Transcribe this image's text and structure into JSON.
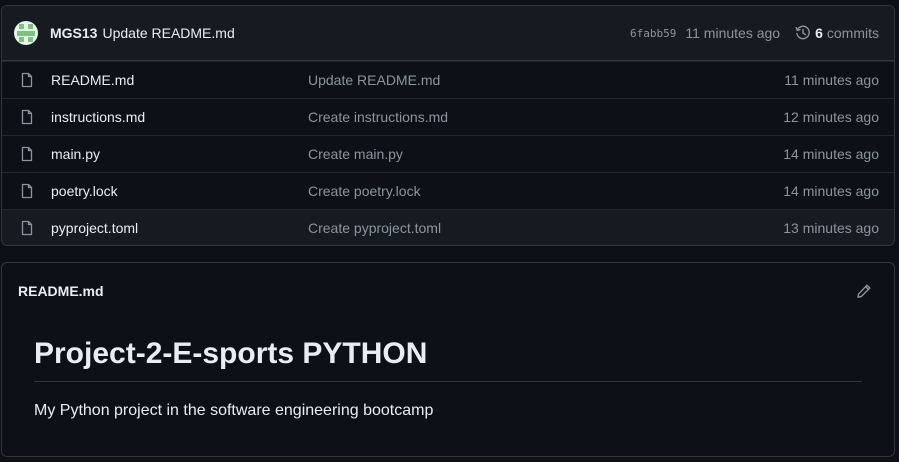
{
  "latest_commit": {
    "author": "MGS13",
    "message": "Update README.md",
    "sha": "6fabb59",
    "time": "11 minutes ago",
    "commits_count": "6",
    "commits_label": "commits"
  },
  "files": [
    {
      "name": "README.md",
      "commit": "Update README.md",
      "time": "11 minutes ago"
    },
    {
      "name": "instructions.md",
      "commit": "Create instructions.md",
      "time": "12 minutes ago"
    },
    {
      "name": "main.py",
      "commit": "Create main.py",
      "time": "14 minutes ago"
    },
    {
      "name": "poetry.lock",
      "commit": "Create poetry.lock",
      "time": "14 minutes ago"
    },
    {
      "name": "pyproject.toml",
      "commit": "Create pyproject.toml",
      "time": "13 minutes ago"
    }
  ],
  "readme": {
    "title": "README.md",
    "heading": "Project-2-E-sports PYTHON",
    "paragraph": "My Python project in the software engineering bootcamp"
  },
  "icons": {
    "file": "file-icon",
    "history": "history-icon",
    "edit": "pencil-icon",
    "avatar": "identicon-avatar"
  },
  "colors": {
    "background": "#0d1117",
    "panel": "#161b22",
    "border": "#30363d",
    "muted_text": "#8b949e",
    "text": "#e6edf3",
    "avatar": "#7bc47f"
  }
}
